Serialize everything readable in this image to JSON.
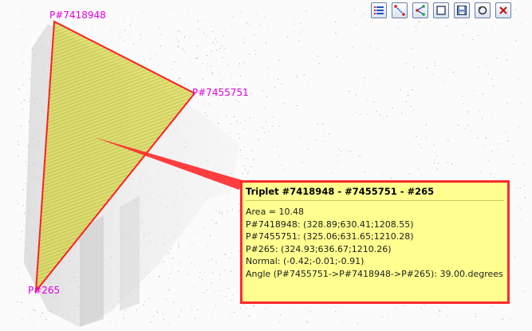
{
  "toolbar": {
    "buttons": [
      {
        "name": "list-icon"
      },
      {
        "name": "line-segment-icon"
      },
      {
        "name": "triangle-icon"
      },
      {
        "name": "square-icon"
      },
      {
        "name": "save-icon"
      },
      {
        "name": "reset-icon"
      },
      {
        "name": "close-icon"
      }
    ]
  },
  "points": {
    "p1": "P#7418948",
    "p2": "P#7455751",
    "p3": "P#265"
  },
  "tooltip": {
    "title": "Triplet #7418948 - #7455751 - #265",
    "lines": [
      "Area = 10.48",
      "P#7418948: (328.89;630.41;1208.55)",
      "P#7455751: (325.06;631.65;1210.28)",
      "P#265: (324.93;636.67;1210.26)",
      "Normal: (-0.42;-0.01;-0.91)",
      "Angle (P#7455751->P#7418948->P#265): 39.00.degrees"
    ]
  },
  "colors": {
    "label": "#e000e0",
    "triangle_edge": "#ff2020",
    "triangle_fill": "#d4d43a",
    "tooltip_bg": "#ffff8f",
    "tooltip_border": "#ff2a2a"
  }
}
